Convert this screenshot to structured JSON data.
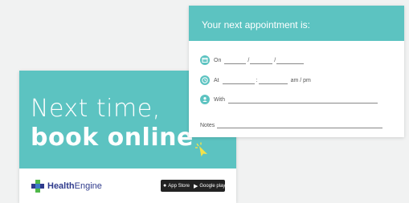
{
  "front": {
    "headline_line1": "Next time,",
    "headline_line2": "book online",
    "logo_health": "Health",
    "logo_engine": "Engine",
    "app_store": "App Store",
    "google_play": "Google play"
  },
  "back": {
    "title": "Your next appointment is:",
    "on_label": "On",
    "at_label": "At",
    "date_sep": "/",
    "time_sep": ":",
    "ampm": "am / pm",
    "with_label": "With",
    "notes_label": "Notes"
  },
  "colors": {
    "teal": "#5cc3c1",
    "cursor_yellow": "#f3e24a",
    "brand_blue": "#2e3a8c",
    "brand_green": "#4fb84a"
  }
}
